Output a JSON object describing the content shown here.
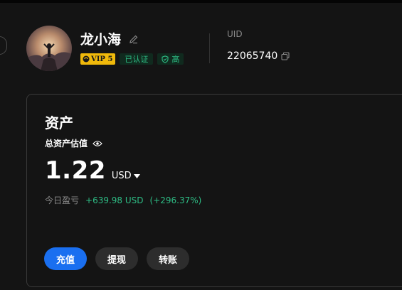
{
  "profile": {
    "username": "龙小海",
    "vip_label": "VIP 5",
    "verified_label": "已认证",
    "level_label": "高",
    "uid_label": "UID",
    "uid_value": "22065740"
  },
  "assets": {
    "title": "资产",
    "total_label": "总资产估值",
    "amount": "1.22",
    "currency": "USD",
    "pnl_label": "今日盈亏",
    "pnl_value": "+639.98 USD",
    "pnl_percent": "(+296.37%)"
  },
  "actions": {
    "deposit": "充值",
    "withdraw": "提现",
    "transfer": "转账"
  },
  "colors": {
    "background": "#141414",
    "accent_blue": "#1a6ff0",
    "profit_green": "#2ebd85",
    "vip_gold": "#f0b90b"
  },
  "icons": [
    "edit-icon",
    "vip-logo-icon",
    "shield-check-icon",
    "copy-icon",
    "eye-icon",
    "caret-down-icon"
  ]
}
